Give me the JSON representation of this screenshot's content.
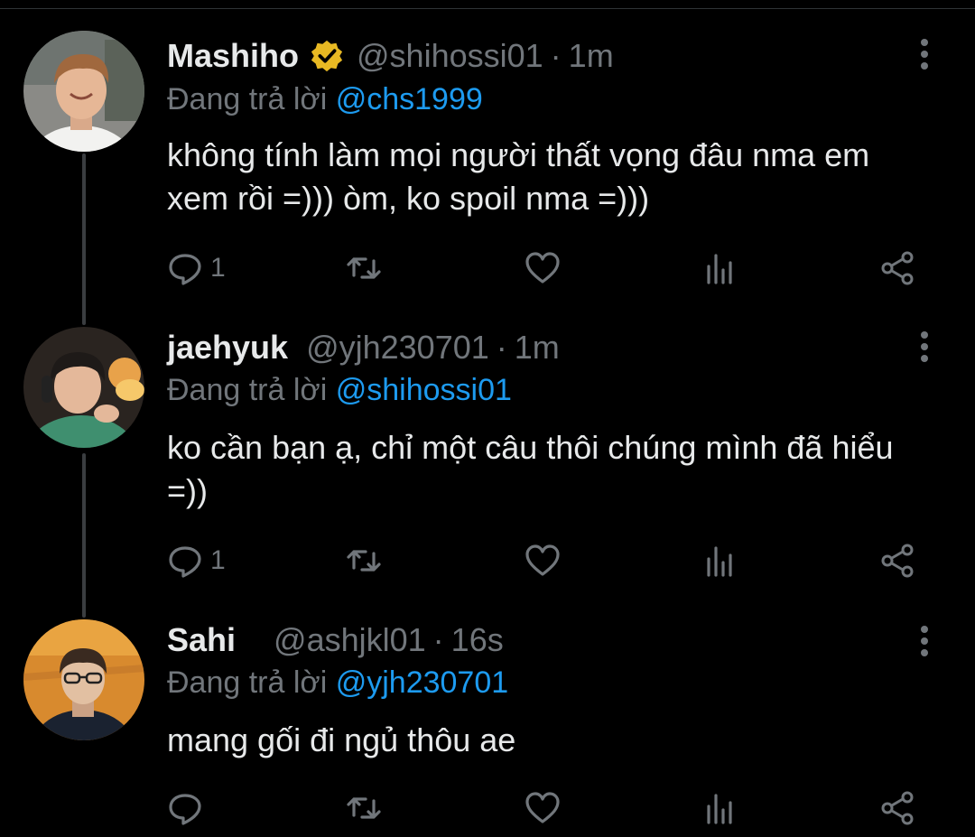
{
  "tweets": [
    {
      "name": "Mashiho",
      "verified": true,
      "handle": "@shihossi01",
      "separator": "·",
      "time": "1m",
      "replying_prefix": "Đang trả lời",
      "replying_to": "@chs1999",
      "text": "không tính làm mọi người thất vọng đâu nma em xem rồi =))) òm, ko spoil nma =)))",
      "reply_count": "1"
    },
    {
      "name": "jaehyuk",
      "verified": false,
      "handle": "@yjh230701",
      "separator": "·",
      "time": "1m",
      "replying_prefix": "Đang trả lời",
      "replying_to": "@shihossi01",
      "text": "ko cần bạn ạ, chỉ một câu thôi chúng mình đã hiểu =))",
      "reply_count": "1"
    },
    {
      "name": "Sahi",
      "verified": false,
      "handle": "@ashjkl01",
      "separator": "·",
      "time": "16s",
      "replying_prefix": "Đang trả lời",
      "replying_to": "@yjh230701",
      "text": "mang gối đi ngủ thôu ae",
      "reply_count": ""
    }
  ],
  "icons": {
    "reply": "reply-icon",
    "retweet": "retweet-icon",
    "like": "like-icon",
    "views": "views-icon",
    "share": "share-icon",
    "more": "more-icon",
    "verified": "verified-badge-icon"
  },
  "colors": {
    "background": "#000000",
    "text": "#e7e9ea",
    "muted": "#71767b",
    "mention": "#1d9bf0",
    "verified_badge": "#e8b923"
  }
}
